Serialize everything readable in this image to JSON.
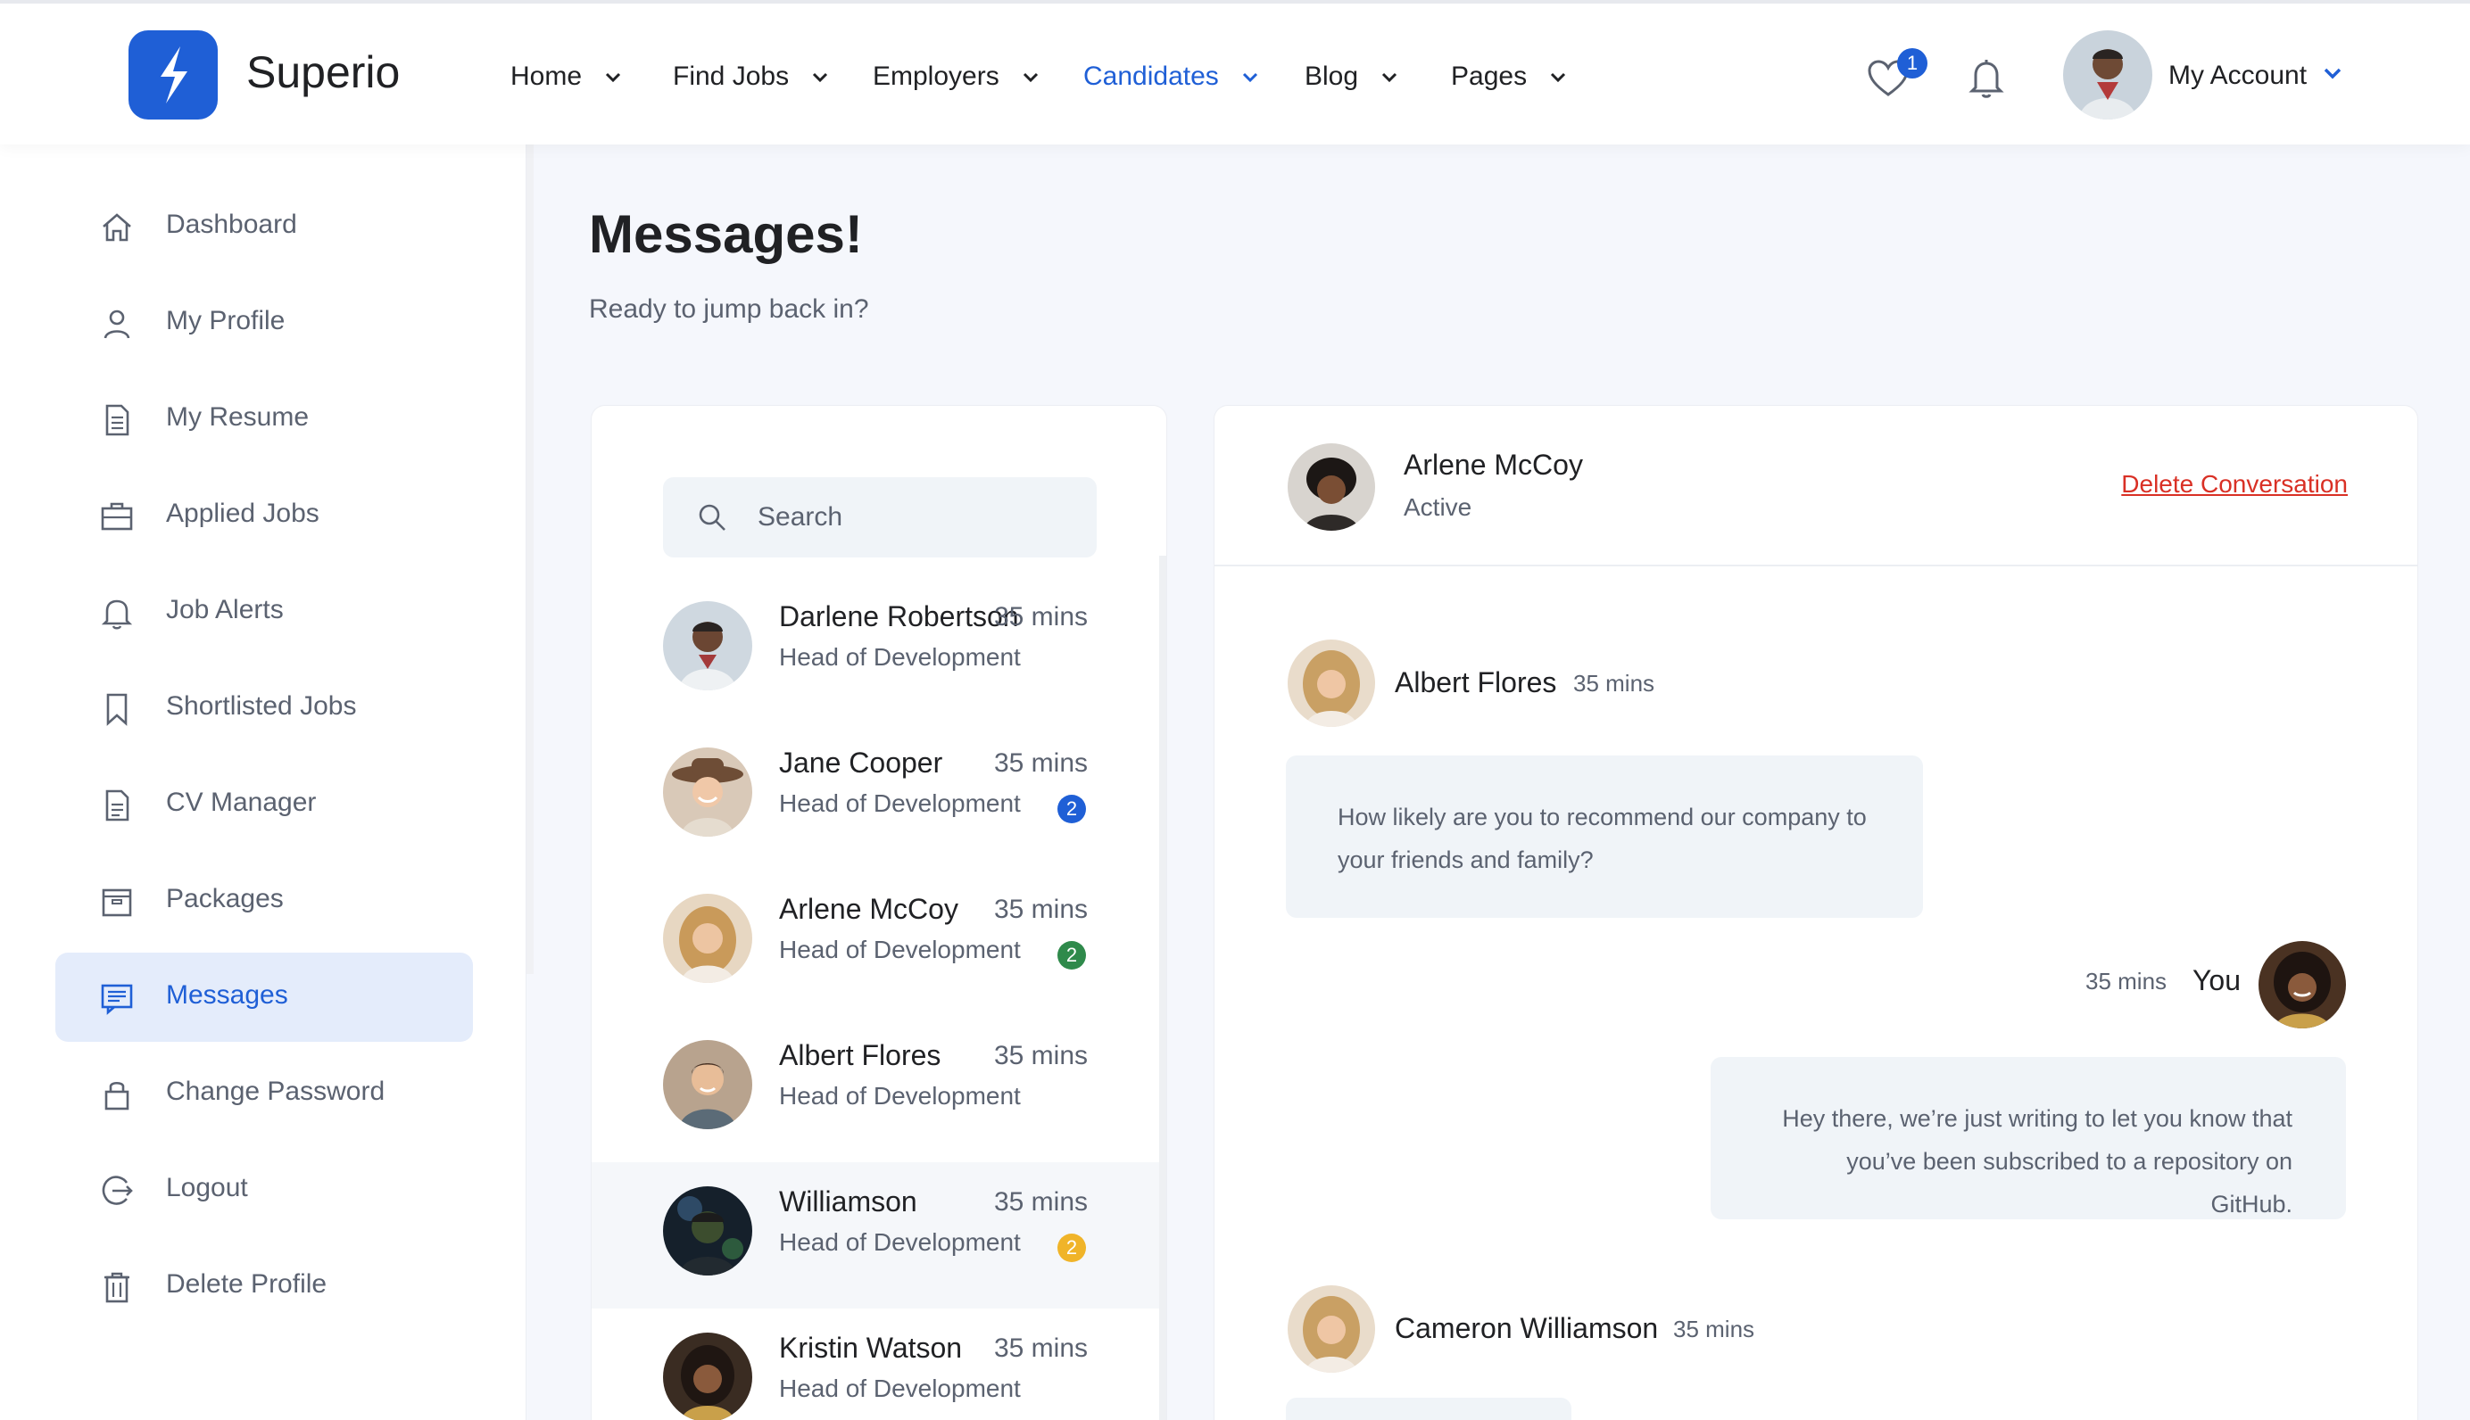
{
  "brand": {
    "name": "Superio"
  },
  "nav": [
    {
      "label": "Home"
    },
    {
      "label": "Find Jobs"
    },
    {
      "label": "Employers"
    },
    {
      "label": "Candidates"
    },
    {
      "label": "Blog"
    },
    {
      "label": "Pages"
    }
  ],
  "header": {
    "favorites_count": "1",
    "account_label": "My Account"
  },
  "sidebar": {
    "items": [
      {
        "label": "Dashboard",
        "icon": "home-icon"
      },
      {
        "label": "My Profile",
        "icon": "user-icon"
      },
      {
        "label": "My Resume",
        "icon": "document-icon"
      },
      {
        "label": "Applied Jobs",
        "icon": "briefcase-icon"
      },
      {
        "label": "Job Alerts",
        "icon": "bell-icon"
      },
      {
        "label": "Shortlisted Jobs",
        "icon": "bookmark-icon"
      },
      {
        "label": "CV Manager",
        "icon": "file-icon"
      },
      {
        "label": "Packages",
        "icon": "package-icon"
      },
      {
        "label": "Messages",
        "icon": "message-icon"
      },
      {
        "label": "Change Password",
        "icon": "lock-icon"
      },
      {
        "label": "Logout",
        "icon": "logout-icon"
      },
      {
        "label": "Delete Profile",
        "icon": "trash-icon"
      }
    ]
  },
  "page": {
    "title": "Messages!",
    "subtitle": "Ready to jump back in?"
  },
  "search": {
    "placeholder": "Search"
  },
  "contacts": [
    {
      "name": "Darlene Robertson",
      "role": "Head of Development",
      "time": "35 mins",
      "badge": ""
    },
    {
      "name": "Jane Cooper",
      "role": "Head of Development",
      "time": "35 mins",
      "badge": "2"
    },
    {
      "name": "Arlene McCoy",
      "role": "Head of Development",
      "time": "35 mins",
      "badge": "2"
    },
    {
      "name": "Albert Flores",
      "role": "Head of Development",
      "time": "35 mins",
      "badge": ""
    },
    {
      "name": "Williamson",
      "role": "Head of Development",
      "time": "35 mins",
      "badge": "2"
    },
    {
      "name": "Kristin Watson",
      "role": "Head of Development",
      "time": "35 mins",
      "badge": ""
    }
  ],
  "colors": {
    "accent": "#1f5fd6",
    "badge_blue": "#1f5fd6",
    "badge_green": "#2f8a4b",
    "badge_yellow": "#f0b429",
    "danger": "#d93025"
  },
  "chat": {
    "name": "Arlene McCoy",
    "status": "Active",
    "delete_label": "Delete Conversation",
    "messages": [
      {
        "author": "Albert Flores",
        "time": "35 mins",
        "text": "How likely are you to recommend our company to your friends and family?"
      },
      {
        "author": "You",
        "time": "35 mins",
        "text": "Hey there, we’re just writing to let you know that you’ve been subscribed to a repository on GitHub."
      },
      {
        "author": "Cameron Williamson",
        "time": "35 mins",
        "text": ""
      }
    ]
  }
}
